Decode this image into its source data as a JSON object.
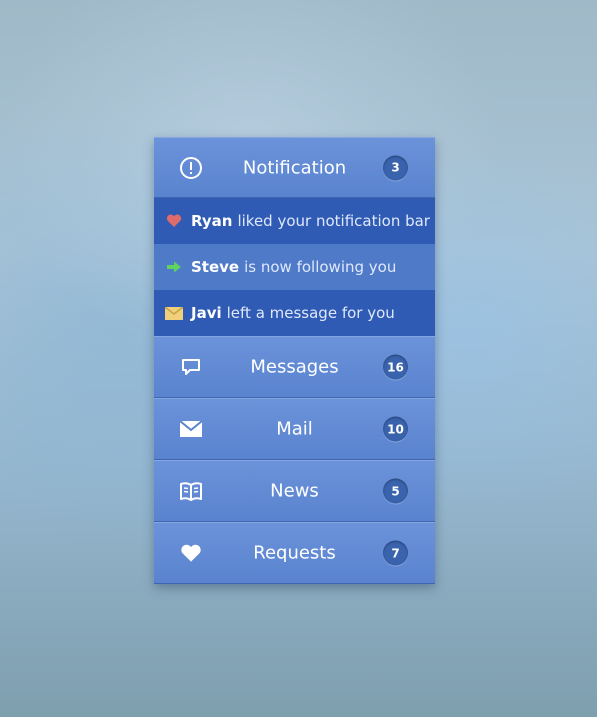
{
  "header": {
    "title": "Notification",
    "count": "3",
    "icon": "exclamation-circle-icon"
  },
  "notifications": [
    {
      "name": "Ryan",
      "text": "liked your notification bar",
      "icon": "heart-icon",
      "icon_color": "#e06b6b"
    },
    {
      "name": "Steve",
      "text": "is now following you",
      "icon": "arrow-right-icon",
      "icon_color": "#5fd35f"
    },
    {
      "name": "Javi",
      "text": "left a message for you",
      "icon": "envelope-icon",
      "icon_color": "#f0d07a"
    }
  ],
  "menu": [
    {
      "label": "Messages",
      "count": "16",
      "icon": "chat-bubble-icon"
    },
    {
      "label": "Mail",
      "count": "10",
      "icon": "envelope-icon"
    },
    {
      "label": "News",
      "count": "5",
      "icon": "book-icon"
    },
    {
      "label": "Requests",
      "count": "7",
      "icon": "heart-icon"
    }
  ],
  "colors": {
    "accent": "#5a83cf",
    "badge": "#3a63ad",
    "notif_dark": "#2f5bb5",
    "notif_light": "#4f7ac8"
  }
}
